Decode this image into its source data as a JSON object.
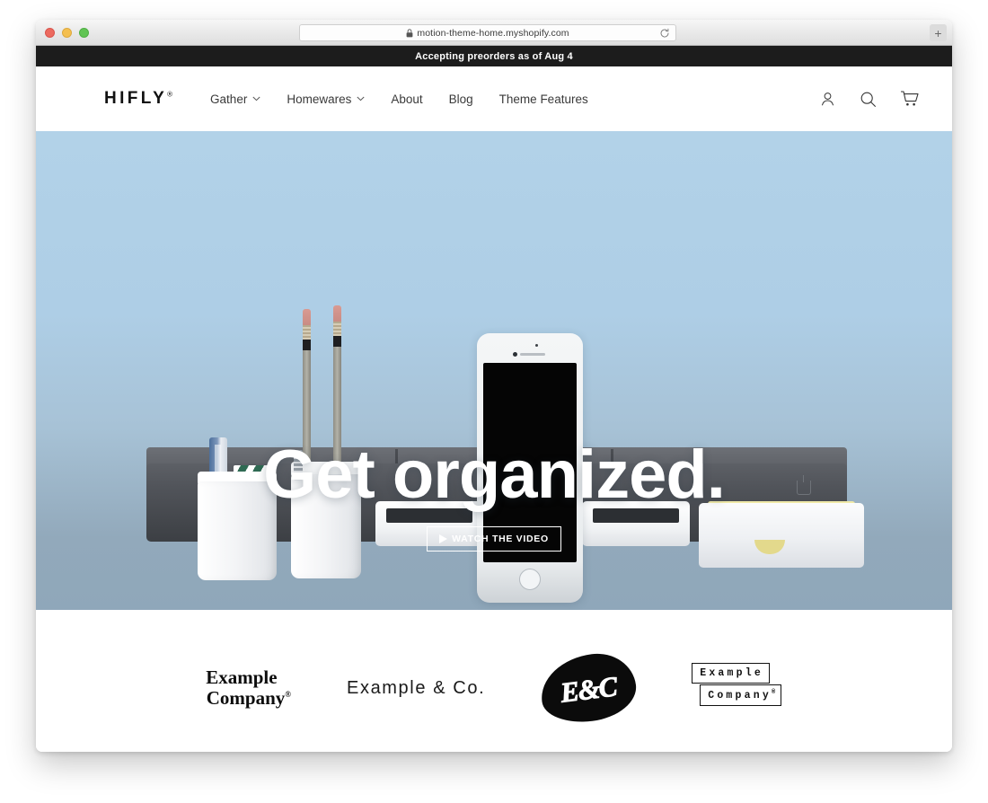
{
  "browser": {
    "url": "motion-theme-home.myshopify.com",
    "lock_icon": "lock-icon",
    "reload_icon": "reload-icon",
    "new_tab_label": "+",
    "traffic_lights": [
      "close",
      "minimize",
      "maximize"
    ]
  },
  "site": {
    "announcement": "Accepting preorders as of Aug 4",
    "header": {
      "brand": "HIFLY",
      "brand_mark": "®",
      "nav": [
        {
          "label": "Gather",
          "has_dropdown": true
        },
        {
          "label": "Homewares",
          "has_dropdown": true
        },
        {
          "label": "About",
          "has_dropdown": false
        },
        {
          "label": "Blog",
          "has_dropdown": false
        },
        {
          "label": "Theme Features",
          "has_dropdown": false
        }
      ],
      "actions": [
        {
          "name": "account-icon"
        },
        {
          "name": "search-icon"
        },
        {
          "name": "cart-icon"
        }
      ]
    },
    "hero": {
      "title": "Get organized.",
      "cta_label": "WATCH THE VIDEO",
      "cta_icon": "play-icon"
    },
    "logo_bar": {
      "logos": [
        {
          "name": "example-company-serif",
          "line1": "Example",
          "line2": "Company",
          "mark": "®"
        },
        {
          "name": "example-and-co",
          "text": "Example & Co."
        },
        {
          "name": "e-and-c-blob",
          "text": "E&C"
        },
        {
          "name": "example-company-boxed",
          "line1": "Example",
          "line2": "Company",
          "mark": "®"
        }
      ]
    }
  },
  "colors": {
    "announcement_bg": "#1c1c1c",
    "text_dark": "#111111",
    "hero_sky": "#aecee6",
    "hero_desk": "#45484d",
    "note_yellow": "#e8e099",
    "page_bg": "#ffffff"
  }
}
